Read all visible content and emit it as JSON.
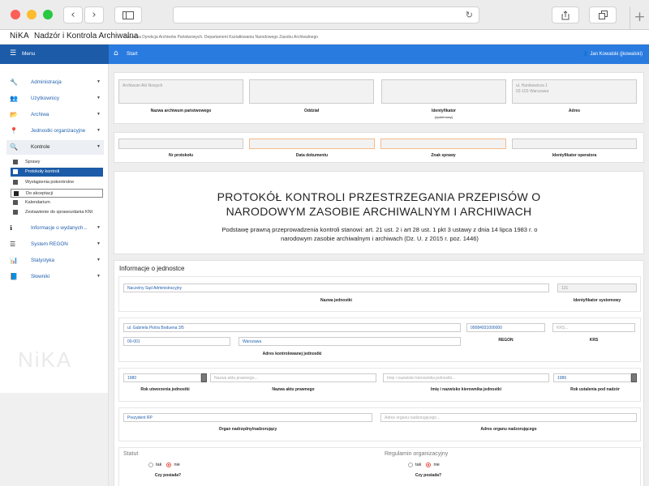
{
  "browser": {
    "back": "‹",
    "forward": "›",
    "reload": "↻",
    "new_tab": "+"
  },
  "app": {
    "logo": "NiKA",
    "title": "Nadzór i Kontrola Archiwalna",
    "subtitle": "Naczelna Dyrekcja Archiwów Państwowych. Departament Kształtowania Narodowego Zasobu Archiwalnego"
  },
  "menu": {
    "label": "Menu"
  },
  "breadcrumb": {
    "home": "Start"
  },
  "user": {
    "name": "Jan Kowalski (jkowalski)"
  },
  "sidebar": {
    "items": [
      {
        "label": "Administracja",
        "icon": "wrench-icon"
      },
      {
        "label": "Użytkownicy",
        "icon": "users-icon"
      },
      {
        "label": "Archiwa",
        "icon": "folder-icon"
      },
      {
        "label": "Jednostki organizacyjne",
        "icon": "map-marker-icon"
      },
      {
        "label": "Kontrole",
        "icon": "search-icon"
      },
      {
        "label": "Informacje o wydanych...",
        "icon": "info-icon"
      },
      {
        "label": "System REGON",
        "icon": "list-icon"
      },
      {
        "label": "Statystyka",
        "icon": "bar-chart-icon"
      },
      {
        "label": "Słowniki",
        "icon": "book-icon"
      }
    ],
    "sub": [
      {
        "label": "Sprawy"
      },
      {
        "label": "Protokoły kontroli"
      },
      {
        "label": "Wystąpienia pokontrolne"
      },
      {
        "label": "Do akceptacji"
      },
      {
        "label": "Kalendarium"
      },
      {
        "label": "Zestawienie do sprawozdania KNI"
      }
    ],
    "watermark": "NiKA"
  },
  "archive": {
    "name_value": "Archiwum Akt Nowych",
    "address_line1": "ul. Hankiewicza 1",
    "address_line2": "02-103 Warszawa",
    "labels": {
      "name": "Nazwa archiwum państwowego",
      "branch": "Oddział",
      "identifier": "Identyfikator",
      "identifier_sub": "(systemowy)",
      "address": "Adres"
    }
  },
  "protocol": {
    "labels": {
      "number": "Nr protokołu",
      "date": "Data dokumentu",
      "case": "Znak sprawy",
      "operator": "Identyfikator operatora"
    }
  },
  "document": {
    "title_line1": "PROTOKÓŁ KONTROLI PRZESTRZEGANIA PRZEPISÓW O",
    "title_line2": "NARODOWYM ZASOBIE ARCHIWALNYM I ARCHIWACH",
    "basis_line1": "Podstawę prawną przeprowadzenia kontroli stanowi: art. 21 ust. 2 i art 28 ust. 1 pkt 3 ustawy z dnia 14 lipca 1983 r. o",
    "basis_line2": "narodowym zasobie archiwalnym i archiwach (Dz. U. z 2015 r. poz. 1446)"
  },
  "unit": {
    "section_title": "Informacje o jednostce",
    "name_value": "Naczelny Sąd Administracyjny",
    "id_value": "131",
    "name_label": "Nazwa jednostki",
    "id_label": "Identyfikator systemowy",
    "street_value": "ul. Gabriela Piotra Boduena 3/5",
    "postal_value": "00-001",
    "city_value": "Warszawa",
    "address_label": "Adres kontrolowanej jednostki",
    "regon_value": "00084931000000",
    "regon_label": "REGON",
    "krs_placeholder": "KRS...",
    "krs_label": "KRS",
    "year_created_value": "1980",
    "year_created_label": "Rok utworzenia jednostki",
    "legal_act_placeholder": "Nazwa aktu prawnego...",
    "legal_act_label": "Nazwa aktu prawnego",
    "head_placeholder": "Imię i nazwisko kierownika jednostki...",
    "head_label": "Imię i nazwisko kierownika jednostki",
    "year_supervision_value": "1986",
    "year_supervision_label": "Rok ustalenia pod nadzór",
    "parent_value": "Prezydent RP",
    "parent_label": "Organ nadrzędny/nadzorujący",
    "parent_address_placeholder": "Adres organu nadzorującego...",
    "parent_address_label": "Adres organu nadzorującego"
  },
  "statute": {
    "title": "Statut",
    "yes": "tak",
    "no": "nie",
    "question": "Czy posiada?",
    "selected": "nie"
  },
  "regulations": {
    "title": "Regulamin organizacyjny",
    "yes": "tak",
    "no": "nie",
    "question": "Czy posiada?",
    "selected": "nie"
  },
  "colors": {
    "menu": "#1c5ba8",
    "topbar": "#2a7be0",
    "link": "#2462b0",
    "warn_border": "#f4b98a"
  }
}
